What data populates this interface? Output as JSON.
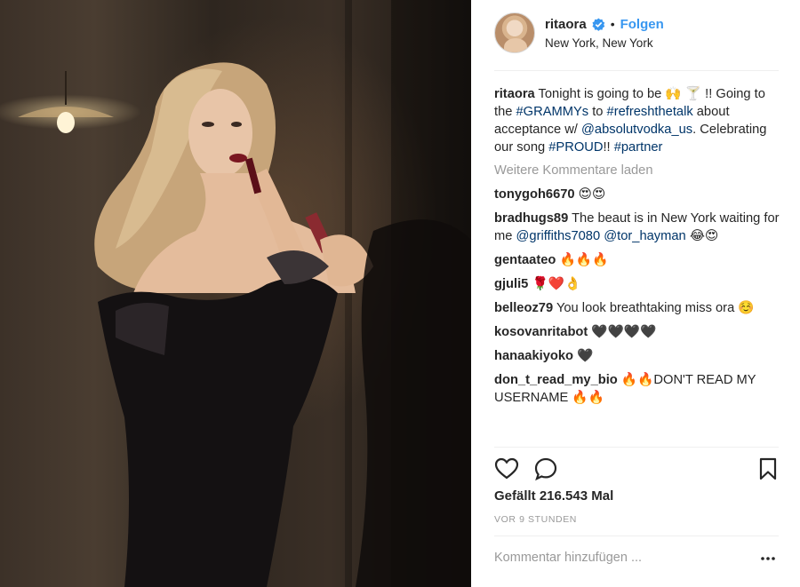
{
  "post": {
    "image_alt": "Woman in black strapless dress applying red lipstick in a dim room",
    "header": {
      "username": "ritaora",
      "verified_icon": "verified-badge-icon",
      "separator": "•",
      "follow_label": "Folgen",
      "location": "New York, New York"
    },
    "caption": {
      "username": "ritaora",
      "text_1": " Tonight is going to be 🙌 🍸 !! Going to the ",
      "tag_1": "#GRAMMYs",
      "text_2": " to ",
      "tag_2": "#refreshthetalk",
      "text_3": " about acceptance w/ ",
      "mention": "@absolutvodka_us",
      "text_4": ". Celebrating our song ",
      "tag_3": "#PROUD",
      "text_5": "!! ",
      "tag_4": "#partner"
    },
    "load_more": "Weitere Kommentare laden",
    "comments": [
      {
        "user": "tonygoh6670",
        "text": " 😍😍"
      },
      {
        "user": "bradhugs89",
        "text": " The beaut is in New York waiting for me ",
        "mention_1": "@griffiths7080",
        "mention_2": "@tor_hayman",
        "text_end": " 😂😍"
      },
      {
        "user": "gentaateo",
        "text": " 🔥🔥🔥"
      },
      {
        "user": "gjuli5",
        "text": " 🌹❤️👌"
      },
      {
        "user": "belleoz79",
        "text": " You look breathtaking miss ora ☺️"
      },
      {
        "user": "kosovanritabot",
        "text": " 🖤🖤🖤🖤"
      },
      {
        "user": "hanaakiyoko",
        "text": " 🖤"
      },
      {
        "user": "don_t_read_my_bio",
        "text": " 🔥🔥DON'T READ MY USERNAME 🔥🔥"
      }
    ],
    "actions": {
      "like_icon": "heart-icon",
      "comment_icon": "comment-bubble-icon",
      "save_icon": "bookmark-icon"
    },
    "likes": "Gefällt 216.543 Mal",
    "time": "VOR 9 STUNDEN",
    "add_comment_placeholder": "Kommentar hinzufügen ...",
    "more_icon": "more-options-icon"
  }
}
